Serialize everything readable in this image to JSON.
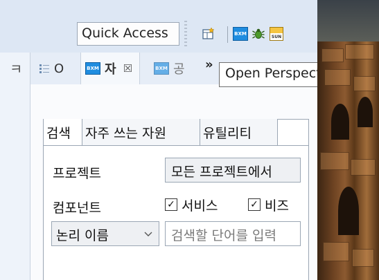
{
  "toolbar": {
    "quick_access": "Quick Access",
    "buttons": [
      {
        "name": "open-perspective-icon"
      },
      {
        "name": "bxm-perspective-icon",
        "label": "BXM"
      },
      {
        "name": "debug-bug-icon"
      },
      {
        "name": "sun-perspective-icon",
        "label": "SUN"
      }
    ]
  },
  "left_view": {
    "glyph": "ㅋ"
  },
  "view_tabs": [
    {
      "label": "O",
      "icon": "outline-icon"
    },
    {
      "label": "자",
      "icon": "bxm-icon",
      "icon_text": "BXM",
      "active": true,
      "close": "☒"
    },
    {
      "label": "공",
      "icon": "bxm-icon",
      "icon_text": "BXM"
    }
  ],
  "overflow": "»",
  "tooltip": "Open Perspective",
  "panel": {
    "tabs": [
      "검색",
      "자주 쓰는 자원",
      "유틸리티"
    ],
    "project_label": "프로젝트",
    "project_value": "모든 프로젝트에서",
    "component_label": "컴포넌트",
    "check_service": "서비스",
    "check_biz": "비즈",
    "check_mark": "✓",
    "name_select": "논리 이름",
    "search_placeholder": "검색할 단어를 입력"
  },
  "colors": {
    "accent": "#1f8de0",
    "toolbar_bg": "#dde7f4"
  }
}
